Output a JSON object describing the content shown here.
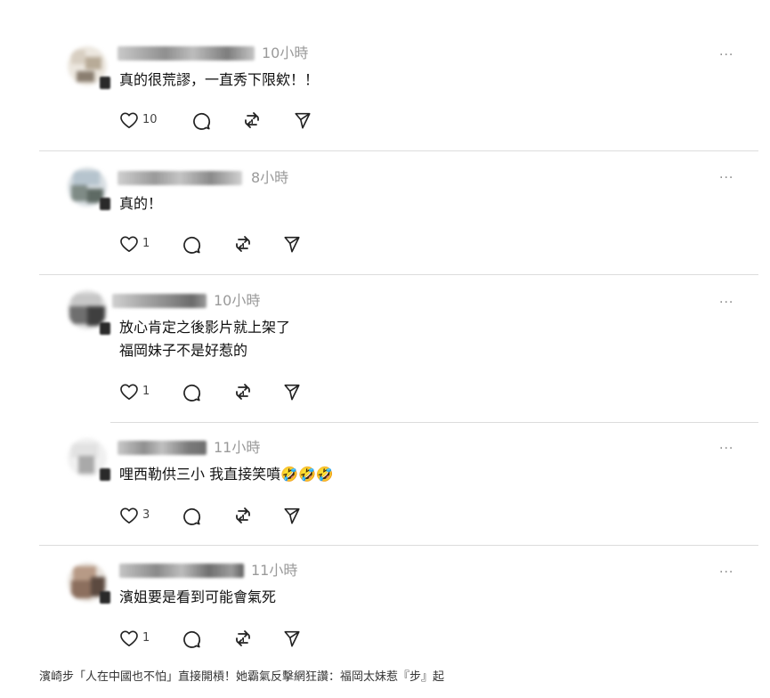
{
  "comments": [
    {
      "time": "10小時",
      "lines": [
        "真的很荒謬，一直秀下限欸！！"
      ],
      "likes": "10"
    },
    {
      "time": "8小時",
      "lines": [
        "真的！"
      ],
      "likes": "1"
    },
    {
      "time": "10小時",
      "lines": [
        "放心肯定之後影片就上架了",
        "福岡妹子不是好惹的"
      ],
      "likes": "1"
    },
    {
      "time": "11小時",
      "lines": [
        "哩西勒供三小 我直接笑噴🤣🤣🤣"
      ],
      "likes": "3"
    },
    {
      "time": "11小時",
      "lines": [
        "濱姐要是看到可能會氣死"
      ],
      "likes": "1"
    }
  ],
  "more_label": "···",
  "caption": "濱崎步「人在中國也不怕」直接開槓！她霸氣反擊網狂讚：福岡太妹惹『步』起",
  "icons": [
    "heart-icon",
    "comment-icon",
    "repost-icon",
    "share-icon",
    "more-icon"
  ]
}
